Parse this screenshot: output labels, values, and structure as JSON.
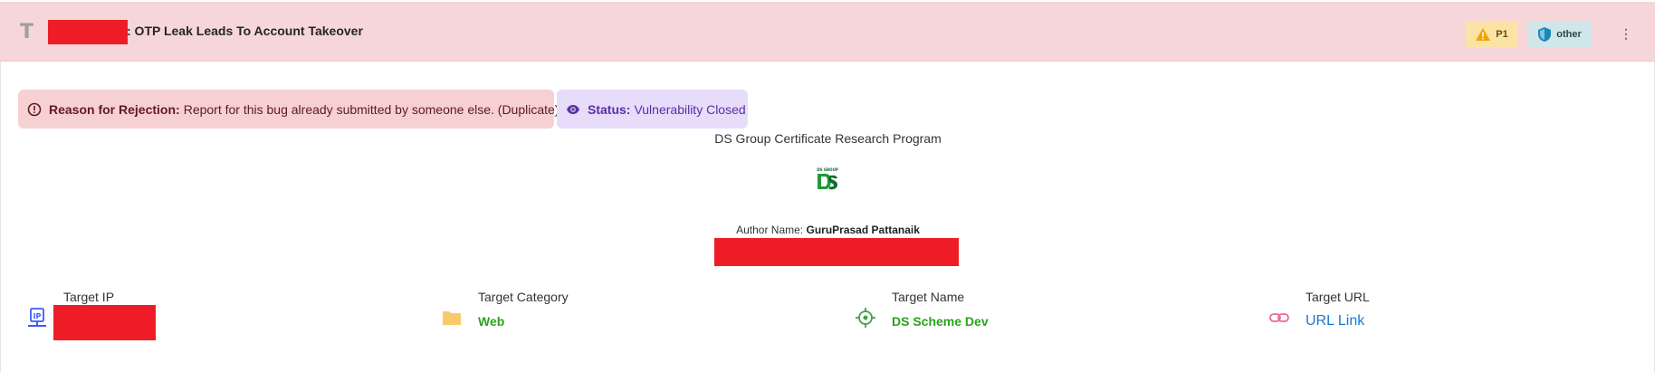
{
  "header": {
    "title": ": OTP Leak Leads To Account Takeover",
    "severity_badge": "P1",
    "category_badge": "other",
    "title_icon": "text-format-icon",
    "menu_icon": "kebab-menu-icon"
  },
  "rejection": {
    "label": "Reason for Rejection:",
    "text": "Report for this bug already submitted by someone else. (Duplicate)",
    "icon": "alert-circle-icon",
    "color": "#f7d0d3"
  },
  "status": {
    "label": "Status:",
    "text": "Vulnerability Closed",
    "icon": "eye-icon",
    "color": "#e7dcfa"
  },
  "program": {
    "name": "DS Group Certificate Research Program",
    "logo": "ds-group-logo",
    "logo_caption": "DS GROUP"
  },
  "author": {
    "label": "Author Name:",
    "name": "GuruPrasad Pattanaik"
  },
  "targets": {
    "ip": {
      "label": "Target IP",
      "icon": "ip-network-icon"
    },
    "category": {
      "label": "Target Category",
      "value": "Web",
      "icon": "folder-icon"
    },
    "name": {
      "label": "Target Name",
      "value": "DS Scheme Dev",
      "icon": "crosshair-icon"
    },
    "url": {
      "label": "Target URL",
      "link_text": "URL Link",
      "icon": "link-icon"
    }
  },
  "colors": {
    "header_bg": "#f7d6da",
    "accent_green": "#2aa31b",
    "link_blue": "#1976d2",
    "redaction": "#ee1c26"
  }
}
